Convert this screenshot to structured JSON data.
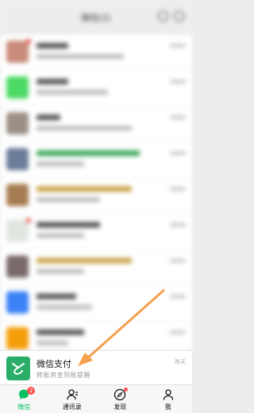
{
  "header": {
    "title": "微信(2)"
  },
  "chats": [
    {
      "accent": "#d9534f"
    },
    {
      "accent": "#4cd964"
    },
    {
      "accent": "#8e8e8e"
    },
    {
      "accent": "#4a6fa5"
    },
    {
      "accent": "#a67c52"
    },
    {
      "accent": "#3aa757"
    },
    {
      "accent": "#7a6a6a"
    },
    {
      "accent": "#3b82f6"
    },
    {
      "accent": "#f59e0b"
    }
  ],
  "wechat_pay": {
    "name": "微信支付",
    "subtitle": "转账资金到账提醒",
    "time": "昨天"
  },
  "tabbar": {
    "tabs": [
      {
        "label": "微信",
        "badge": "2"
      },
      {
        "label": "通讯录"
      },
      {
        "label": "发现"
      },
      {
        "label": "我"
      }
    ]
  },
  "colors": {
    "brand_green": "#07c160",
    "pay_green": "#2aae67",
    "arrow_orange": "#f5a04c",
    "badge_red": "#fa5151"
  }
}
